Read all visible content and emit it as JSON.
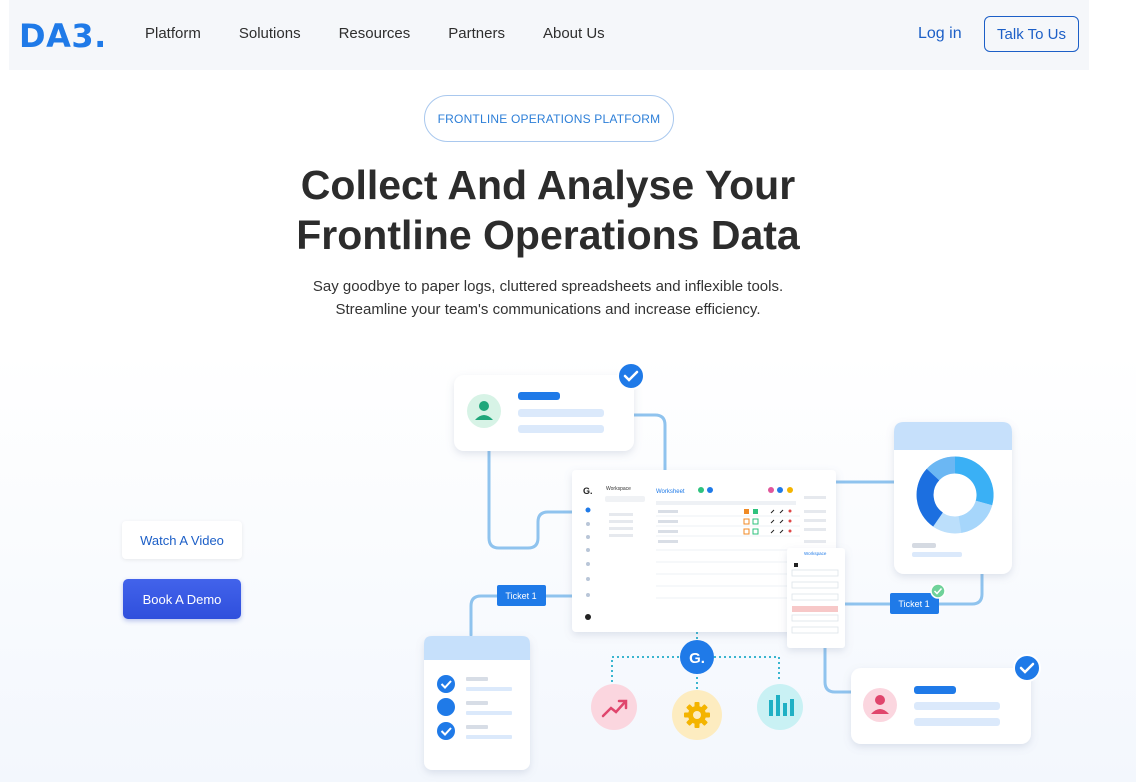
{
  "nav": {
    "logo": "DA3.",
    "links": [
      "Platform",
      "Solutions",
      "Resources",
      "Partners",
      "About Us"
    ],
    "login": "Log in",
    "cta": "Talk To Us"
  },
  "hero": {
    "badge": "FRONTLINE OPERATIONS PLATFORM",
    "headline_line1": "Collect And Analyse Your",
    "headline_line2": "Frontline Operations Data",
    "sub_line1": "Say goodbye to paper logs, cluttered spreadsheets and inflexible tools.",
    "sub_line2": "Streamline your team's communications and increase efficiency.",
    "watch_video": "Watch A Video",
    "book_demo": "Book A Demo"
  },
  "illustration": {
    "ticket_left": "Ticket 1",
    "ticket_right": "Ticket 1",
    "hub_letter": "G.",
    "dashboard_logo": "G.",
    "dashboard_workspace": "Workspace",
    "dashboard_worksheet": "Worksheet",
    "panel_workspace": "Workspace"
  },
  "colors": {
    "brand_blue": "#1f7ae8",
    "link_blue": "#1c5fc7",
    "demo_button": "#3a5be6",
    "connector": "#8fc3ee"
  }
}
